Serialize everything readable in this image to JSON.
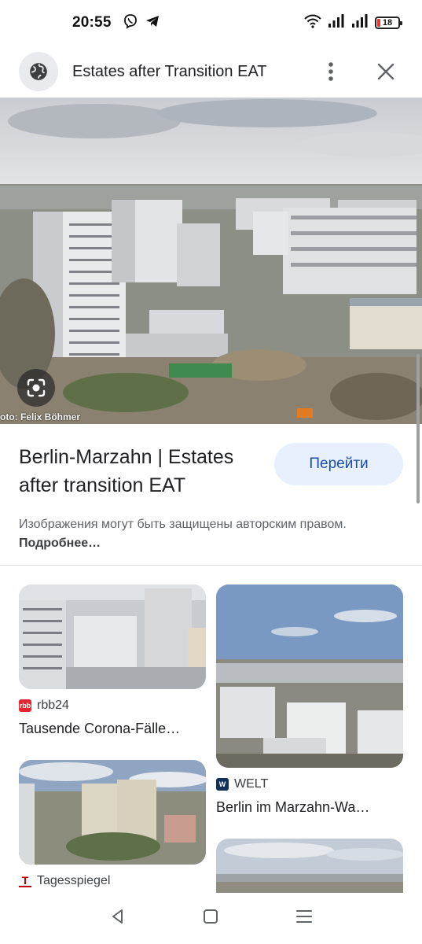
{
  "status_bar": {
    "time": "20:55",
    "battery": "18",
    "left_icons": [
      "viber-icon",
      "telegram-icon"
    ],
    "right_icons": [
      "wifi-icon",
      "signal-icon",
      "signal-icon",
      "battery-icon"
    ]
  },
  "app_bar": {
    "title": "Estates after Transition EAT",
    "icons": [
      "globe-icon",
      "more-vert-icon",
      "close-icon"
    ]
  },
  "hero": {
    "photo_credit": "oto: Felix Böhmer",
    "lens_icon": "google-lens-icon"
  },
  "result": {
    "title": "Berlin-Marzahn | Estates after transition EAT",
    "go_button": "Перейти",
    "copyright_text": "Изображения могут быть защищены авторским правом.",
    "more_link": "Подробнее…"
  },
  "related": [
    {
      "source": "rbb24",
      "source_badge": "rbb",
      "source_color": "#e3262f",
      "title": "Tausende Corona-Fälle…"
    },
    {
      "source": "WELT",
      "source_badge": "W",
      "source_color": "#12315b",
      "title": "Berlin im Marzahn-Wa…"
    },
    {
      "source": "Tagesspiegel",
      "source_badge": "T",
      "source_color": "#c00000",
      "title": ""
    },
    {
      "source": "",
      "source_badge": "",
      "source_color": "",
      "title": ""
    }
  ],
  "nav_bar": {
    "icons": [
      "back-icon",
      "home-icon",
      "menu-icon"
    ]
  },
  "colors": {
    "accent": "#174ea6",
    "button_bg": "#e8f0fe",
    "text_secondary": "#5f6368"
  }
}
